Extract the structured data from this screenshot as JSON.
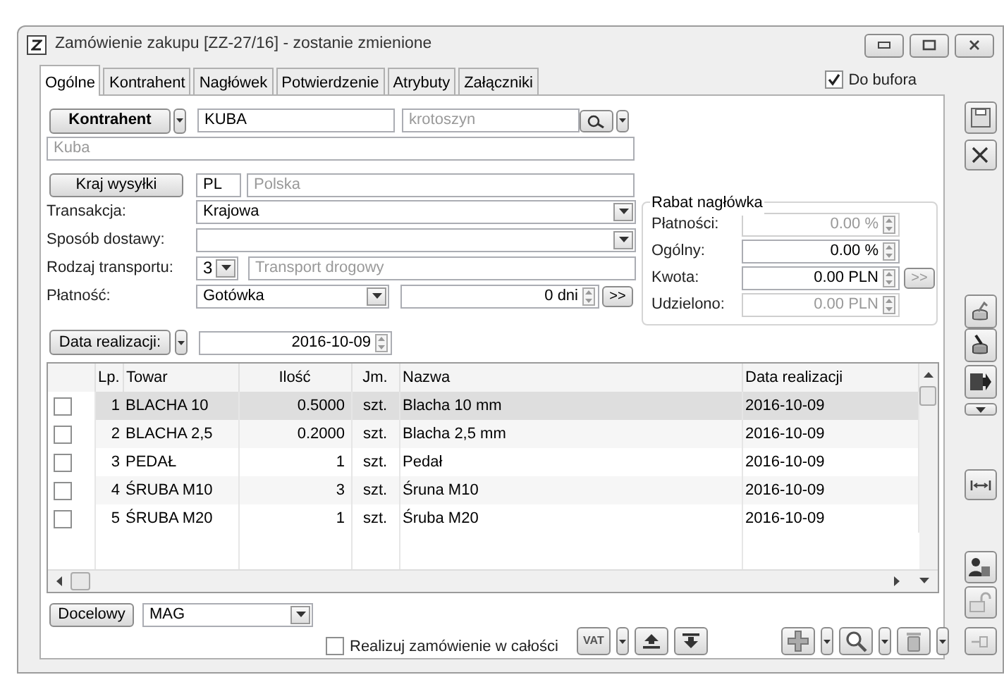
{
  "window": {
    "title": "Zamówienie zakupu [ZZ-27/16] - zostanie zmienione"
  },
  "tabs": [
    {
      "label": "Ogólne",
      "selected": true
    },
    {
      "label": "Kontrahent",
      "selected": false
    },
    {
      "label": "Nagłówek",
      "selected": false
    },
    {
      "label": "Potwierdzenie",
      "selected": false
    },
    {
      "label": "Atrybuty",
      "selected": false
    },
    {
      "label": "Załączniki",
      "selected": false
    }
  ],
  "do_bufora": {
    "label": "Do bufora",
    "checked": true
  },
  "kontrahent": {
    "button": "Kontrahent",
    "code": "KUBA",
    "city": "krotoszyn",
    "name": "Kuba"
  },
  "kraj_wysylki": {
    "button": "Kraj wysyłki",
    "code": "PL",
    "name": "Polska"
  },
  "transakcja": {
    "label": "Transakcja:",
    "value": "Krajowa"
  },
  "sposob_dostawy": {
    "label": "Sposób dostawy:"
  },
  "rodzaj_transportu": {
    "label": "Rodzaj transportu:",
    "code": "3",
    "name": "Transport drogowy"
  },
  "platnosc": {
    "label": "Płatność:",
    "value": "Gotówka",
    "days": "0 dni",
    "more": ">>"
  },
  "data_realizacji": {
    "button": "Data realizacji:",
    "value": "2016-10-09"
  },
  "rabat": {
    "title": "Rabat nagłówka",
    "rows": [
      {
        "label": "Płatności:",
        "value": "0.00 %",
        "disabled": true
      },
      {
        "label": "Ogólny:",
        "value": "0.00 %",
        "disabled": false
      },
      {
        "label": "Kwota:",
        "value": "0.00 PLN",
        "disabled": false,
        "more": ">>"
      },
      {
        "label": "Udzielono:",
        "value": "0.00 PLN",
        "disabled": true
      }
    ]
  },
  "table": {
    "columns": [
      "Lp.",
      "Towar",
      "Ilość",
      "Jm.",
      "Nazwa",
      "Data realizacji"
    ],
    "rows": [
      {
        "checked": false,
        "selected": true,
        "cells": [
          "1",
          "BLACHA 10",
          "0.5000",
          "szt.",
          "Blacha 10 mm",
          "2016-10-09"
        ]
      },
      {
        "checked": false,
        "selected": false,
        "cells": [
          "2",
          "BLACHA 2,5",
          "0.2000",
          "szt.",
          "Blacha 2,5 mm",
          "2016-10-09"
        ]
      },
      {
        "checked": false,
        "selected": false,
        "cells": [
          "3",
          "PEDAŁ",
          "1",
          "szt.",
          "Pedał",
          "2016-10-09"
        ]
      },
      {
        "checked": false,
        "selected": false,
        "cells": [
          "4",
          "ŚRUBA M10",
          "3",
          "szt.",
          "Śruna M10",
          "2016-10-09"
        ]
      },
      {
        "checked": false,
        "selected": false,
        "cells": [
          "5",
          "ŚRUBA M20",
          "1",
          "szt.",
          "Śruba M20",
          "2016-10-09"
        ]
      }
    ]
  },
  "docelowy": {
    "button": "Docelowy",
    "value": "MAG"
  },
  "realizuj": {
    "label": "Realizuj zamówienie w całości",
    "checked": false
  },
  "vat_button": "VAT"
}
